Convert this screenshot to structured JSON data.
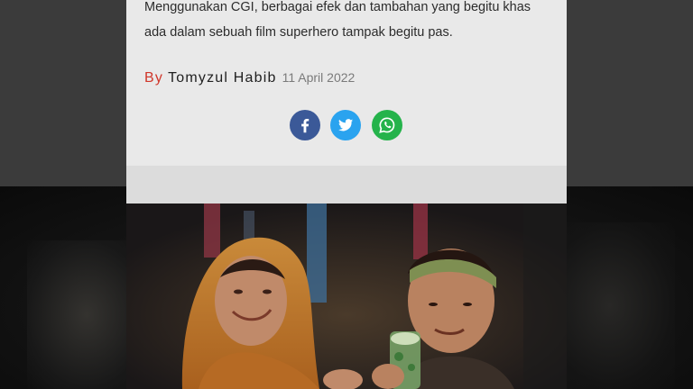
{
  "article": {
    "text": "Menggunakan CGI, berbagai efek dan tambahan yang begitu khas ada dalam sebuah film superhero tampak begitu pas.",
    "byline": {
      "by_label": "By",
      "author": "Tomyzul Habib",
      "date": "11 April 2022"
    }
  },
  "share": {
    "buttons": [
      {
        "name": "facebook",
        "icon": "facebook-icon",
        "color": "#3b5998"
      },
      {
        "name": "twitter",
        "icon": "twitter-icon",
        "color": "#2aa3ef"
      },
      {
        "name": "whatsapp",
        "icon": "whatsapp-icon",
        "color": "#25b34b"
      }
    ]
  },
  "photo": {
    "description_icon": "article-photo"
  },
  "colors": {
    "accent_by": "#d0362a",
    "card_background": "#e9e9e9"
  }
}
